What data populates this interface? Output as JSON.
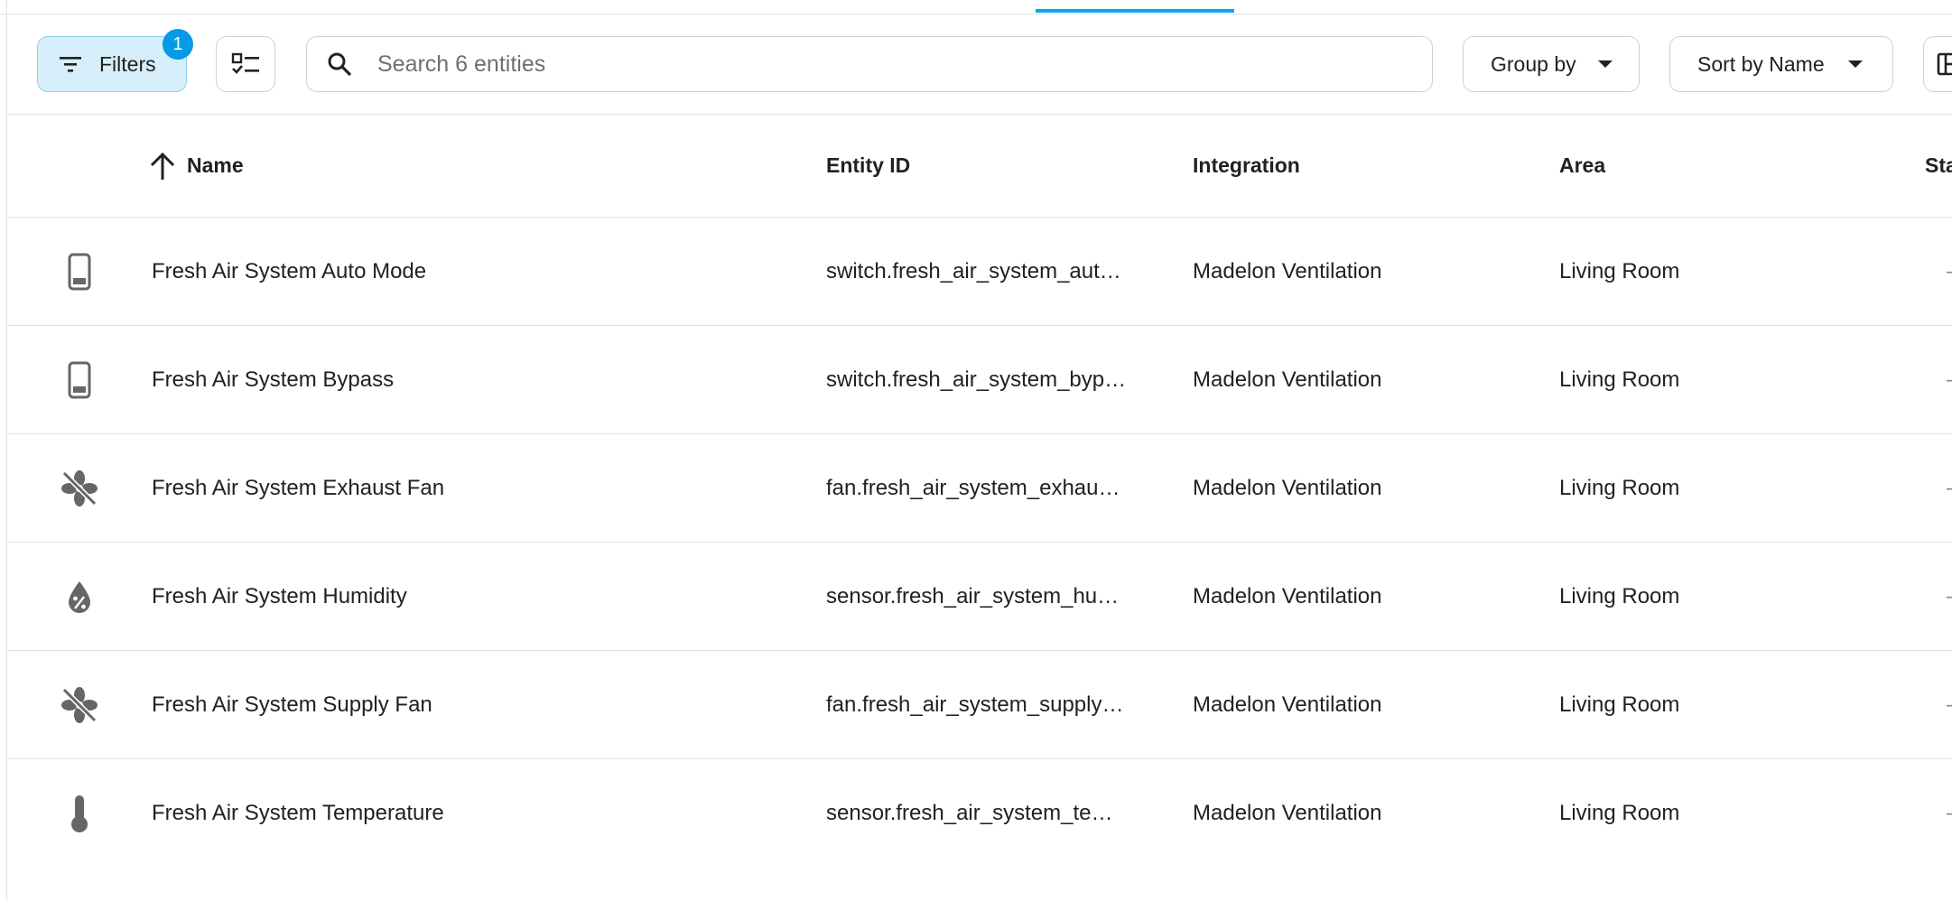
{
  "toolbar": {
    "filters_label": "Filters",
    "filters_badge": "1",
    "search_placeholder": "Search 6 entities",
    "group_by_label": "Group by",
    "sort_label": "Sort by Name"
  },
  "table": {
    "columns": {
      "name": "Name",
      "entity_id": "Entity ID",
      "integration": "Integration",
      "area": "Area",
      "status": "Sta"
    },
    "sort_direction_icon": "arrow-up-icon",
    "rows": [
      {
        "icon": "phone-icon",
        "name": "Fresh Air System Auto Mode",
        "entity_id": "switch.fresh_air_system_aut…",
        "integration": "Madelon Ventilation",
        "area": "Living Room",
        "status": "–"
      },
      {
        "icon": "phone-icon",
        "name": "Fresh Air System Bypass",
        "entity_id": "switch.fresh_air_system_byp…",
        "integration": "Madelon Ventilation",
        "area": "Living Room",
        "status": "–"
      },
      {
        "icon": "fan-off-icon",
        "name": "Fresh Air System Exhaust Fan",
        "entity_id": "fan.fresh_air_system_exhau…",
        "integration": "Madelon Ventilation",
        "area": "Living Room",
        "status": "–"
      },
      {
        "icon": "water-percent-icon",
        "name": "Fresh Air System Humidity",
        "entity_id": "sensor.fresh_air_system_hu…",
        "integration": "Madelon Ventilation",
        "area": "Living Room",
        "status": "–"
      },
      {
        "icon": "fan-off-icon",
        "name": "Fresh Air System Supply Fan",
        "entity_id": "fan.fresh_air_system_supply…",
        "integration": "Madelon Ventilation",
        "area": "Living Room",
        "status": "–"
      },
      {
        "icon": "thermometer-icon",
        "name": "Fresh Air System Temperature",
        "entity_id": "sensor.fresh_air_system_te…",
        "integration": "Madelon Ventilation",
        "area": "Living Room",
        "status": "–"
      }
    ]
  },
  "colors": {
    "accent": "#03a9f4",
    "badge": "#039be5",
    "filters_bg": "#d6eef9",
    "icon": "#666666"
  }
}
